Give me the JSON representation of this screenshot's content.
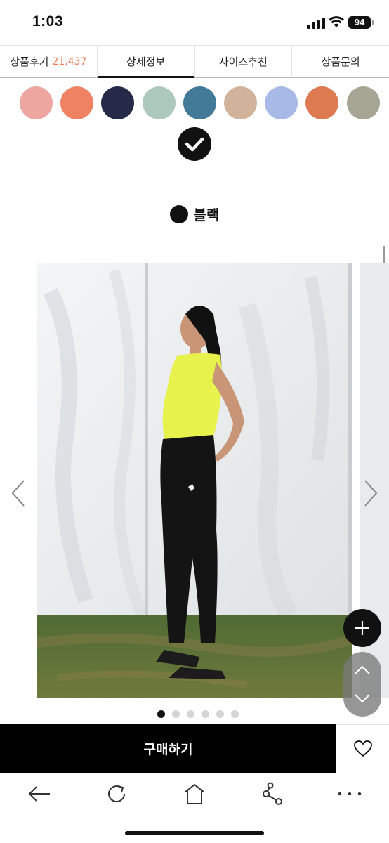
{
  "status_bar": {
    "time": "1:03",
    "battery": "94"
  },
  "tabs": [
    {
      "label": "상품후기",
      "count": "21,437",
      "active": false
    },
    {
      "label": "상세정보",
      "active": true
    },
    {
      "label": "사이즈추천",
      "active": false
    },
    {
      "label": "상품문의",
      "active": false
    }
  ],
  "swatches": [
    "#eda7a0",
    "#f08264",
    "#252a48",
    "#adc9bd",
    "#437a98",
    "#d1b39c",
    "#a8b9e6",
    "#de7a52",
    "#a7a694"
  ],
  "selected_color": {
    "name": "블랙",
    "hex": "#111111",
    "icon": "checkmark-icon"
  },
  "carousel": {
    "slide_count": 6,
    "active_index": 0,
    "image_description_icon": "product-photo"
  },
  "fab": {
    "plus_icon": "plus-icon",
    "scroll_up_icon": "chevron-up-icon",
    "scroll_down_icon": "chevron-down-icon"
  },
  "buy_bar": {
    "buy_label": "구매하기",
    "wish_icon": "heart-icon"
  },
  "browser_nav": {
    "icons": [
      "back-arrow-icon",
      "refresh-icon",
      "home-icon",
      "share-icon",
      "more-icon"
    ]
  },
  "colors": {
    "accent": "#f07e5a",
    "primary": "#000000"
  }
}
